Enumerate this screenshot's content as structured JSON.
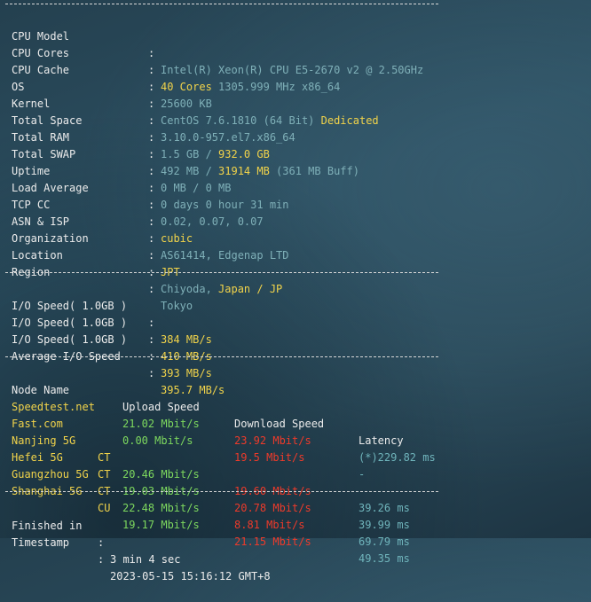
{
  "sysinfo": {
    "cpu_model": {
      "label": "CPU Model",
      "value": "Intel(R) Xeon(R) CPU E5-2670 v2 @ 2.50GHz"
    },
    "cpu_cores": {
      "label": "CPU Cores",
      "cores": "40 Cores",
      "rest": " 1305.999 MHz x86_64"
    },
    "cpu_cache": {
      "label": "CPU Cache",
      "value": "25600 KB"
    },
    "os": {
      "label": "OS",
      "value": "CentOS 7.6.1810 (64 Bit) ",
      "type": "Dedicated"
    },
    "kernel": {
      "label": "Kernel",
      "value": "3.10.0-957.el7.x86_64"
    },
    "total_space": {
      "label": "Total Space",
      "used": "1.5 GB / ",
      "total": "932.0 GB"
    },
    "total_ram": {
      "label": "Total RAM",
      "used": "492 MB / ",
      "total": "31914 MB",
      "buff": " (361 MB Buff)"
    },
    "total_swap": {
      "label": "Total SWAP",
      "value": "0 MB / 0 MB"
    },
    "uptime": {
      "label": "Uptime",
      "value": "0 days 0 hour 31 min"
    },
    "load_average": {
      "label": "Load Average",
      "value": "0.02, 0.07, 0.07"
    },
    "tcp_cc": {
      "label": "TCP CC",
      "value": "cubic"
    },
    "asn_isp": {
      "label": "ASN & ISP",
      "value": "AS61414, Edgenap LTD"
    },
    "organization": {
      "label": "Organization",
      "value": "JPT"
    },
    "location": {
      "label": "Location",
      "city": "Chiyoda, ",
      "country": "Japan / JP"
    },
    "region": {
      "label": "Region",
      "value": "Tokyo"
    },
    "colon": ":",
    "separator": "--------------------------------------------------------------------"
  },
  "io": {
    "rows": [
      {
        "label": "I/O Speed( 1.0GB )",
        "value": "384 MB/s"
      },
      {
        "label": "I/O Speed( 1.0GB )",
        "value": "410 MB/s"
      },
      {
        "label": "I/O Speed( 1.0GB )",
        "value": "393 MB/s"
      }
    ],
    "average": {
      "label": "Average I/O Speed",
      "value": "395.7 MB/s"
    }
  },
  "speedtest": {
    "headers": {
      "node": "Node Name",
      "upload": "Upload Speed",
      "download": "Download Speed",
      "latency": "Latency"
    },
    "rows": [
      {
        "node": "Speedtest.net",
        "isp": "",
        "upload": "21.02 Mbit/s",
        "download": "23.92 Mbit/s",
        "latency": "(*)229.82 ms"
      },
      {
        "node": "Fast.com",
        "isp": "",
        "upload": "0.00 Mbit/s",
        "download": "19.5 Mbit/s",
        "latency": "-"
      },
      {
        "node": "Nanjing 5G",
        "isp": "CT",
        "upload": "20.46 Mbit/s",
        "download": "19.60 Mbit/s",
        "latency": "39.26 ms"
      },
      {
        "node": "Hefei 5G",
        "isp": "CT",
        "upload": "19.03 Mbit/s",
        "download": "20.78 Mbit/s",
        "latency": "39.99 ms"
      },
      {
        "node": "Guangzhou 5G",
        "isp": "CT",
        "upload": "22.48 Mbit/s",
        "download": "8.81 Mbit/s",
        "latency": "69.79 ms"
      },
      {
        "node": "Shanghai 5G",
        "isp": "CU",
        "upload": "19.17 Mbit/s",
        "download": "21.15 Mbit/s",
        "latency": "49.35 ms"
      }
    ]
  },
  "footer": {
    "finished": {
      "label": "Finished in",
      "value": "3 min 4 sec"
    },
    "timestamp": {
      "label": "Timestamp",
      "value": "2023-05-15 15:16:12 GMT+8"
    }
  },
  "colors": {
    "background": "#2a4a5a",
    "label": "#ececec",
    "value_cyan": "#7fb0b8",
    "value_yellow": "#f1d34a",
    "value_green": "#7dd85e",
    "value_red": "#ee3a2a"
  }
}
